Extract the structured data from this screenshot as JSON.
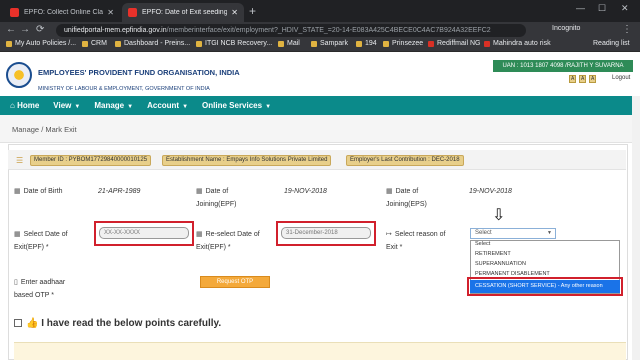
{
  "browser": {
    "tabs": [
      {
        "title": "EPFO: Collect Online Claim Reque"
      },
      {
        "title": "EPFO: Date of Exit seeding by Me"
      }
    ],
    "new_tab": "+",
    "min": "—",
    "max": "☐",
    "close": "✕",
    "url_host": "unifiedportal-mem.epfindia.gov.in",
    "url_path": "/memberinterface/exit/employment?_HDIV_STATE_=20-14-E083A425C4BECE0C4AC7B924A32EEFC2",
    "incognito": "Incognito",
    "bookmarks": [
      "My Auto Policies /...",
      "CRM",
      "Dashboard - Preins...",
      "ITGI NCB Recovery...",
      "Mail",
      "Sampark",
      "194",
      "Prinsezee",
      "Rediffmail NG",
      "Mahindra auto risk"
    ],
    "reading_list": "Reading list"
  },
  "header": {
    "org_name": "EMPLOYEES' PROVIDENT FUND ORGANISATION, INDIA",
    "ministry": "MINISTRY OF LABOUR & EMPLOYMENT, GOVERNMENT OF INDIA",
    "uan": "UAN : 1013 1807 4098 /RAJITH Y SUVARNA",
    "font_a1": "A",
    "font_a2": "A",
    "font_a3": "A",
    "logout": "Logout"
  },
  "menu": {
    "home": "Home",
    "view": "View",
    "manage": "Manage",
    "account": "Account",
    "online_services": "Online Services"
  },
  "breadcrumb": {
    "parent": "Manage",
    "sep": "/",
    "current": "Mark Exit"
  },
  "info_bar": {
    "member_id": "Member ID : PYBOM17729840000010125",
    "establishment": "Establishment Name : Empays Info Solutions Private Limited",
    "last_contribution": "Employer's Last Contribution : DEC-2018"
  },
  "form": {
    "dob_label": "Date of Birth",
    "dob_value": "21-APR-1989",
    "doj_epf_label1": "Date of",
    "doj_epf_label2": "Joining(EPF)",
    "doj_epf_value": "19-NOV-2018",
    "doj_eps_label1": "Date of",
    "doj_eps_label2": "Joining(EPS)",
    "doj_eps_value": "19-NOV-2018",
    "exit_date_label1": "Select Date of",
    "exit_date_label2": "Exit(EPF) *",
    "exit_date_placeholder": "XX-XX-XXXX",
    "reselect_label1": "Re-select Date of",
    "reselect_label2": "Exit(EPF) *",
    "reselect_value": "31-December-2018",
    "reason_label1": "Select reason of",
    "reason_label2": "Exit *",
    "reason_selected": "Select",
    "reason_options": [
      "Select",
      "RETIREMENT",
      "SUPERANNUATION",
      "PERMANENT DISABLEMENT"
    ],
    "reason_highlighted": "CESSATION (SHORT SERVICE) - Any other reason",
    "aadhaar_label1": "Enter aadhaar",
    "aadhaar_label2": "based OTP *",
    "otp_button": "Request OTP",
    "agree_text": "I have read the below points carefully."
  },
  "colors": {
    "menu_bg": "#0b8a8a",
    "uan_bg": "#2e8b57",
    "highlight": "#1a73e8",
    "annotation_red": "#d1202c",
    "otp_button": "#f4a93a"
  }
}
